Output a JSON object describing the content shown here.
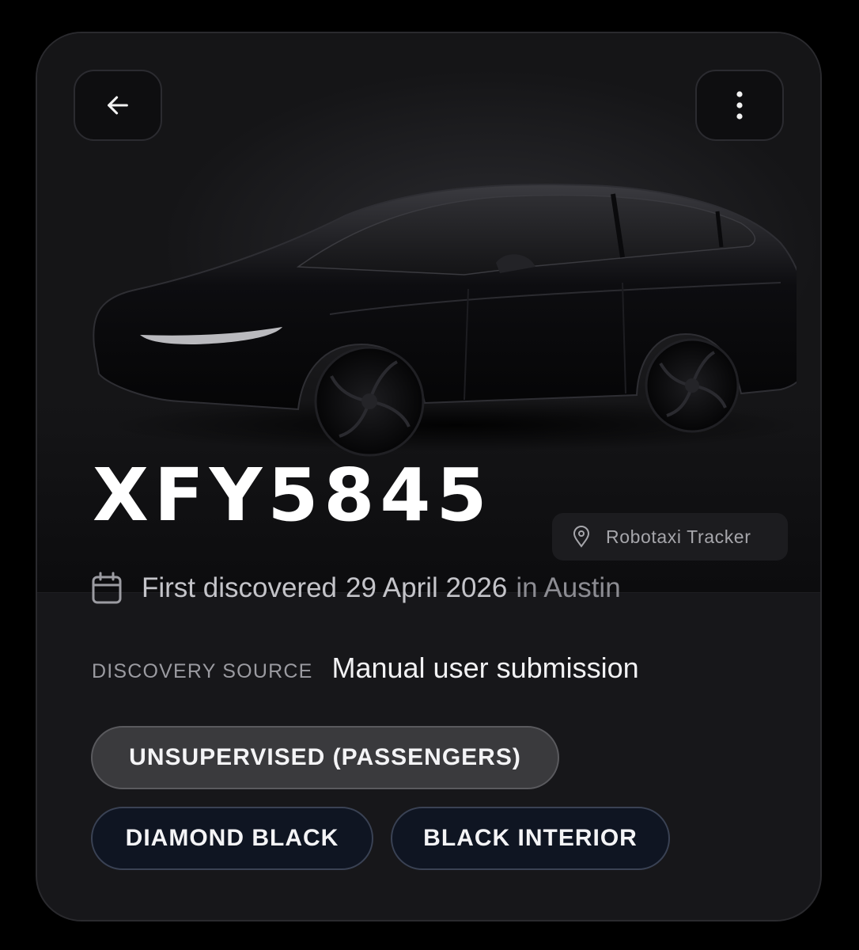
{
  "vehicle": {
    "plate": "XFY5845",
    "discovered_prefix": "First discovered",
    "discovered_date": "29 April 2026",
    "discovered_in": "in Austin",
    "discovery_source_label": "DISCOVERY SOURCE",
    "discovery_source_value": "Manual user submission"
  },
  "badge": {
    "label": "Robotaxi Tracker",
    "icon": "location-pin-icon"
  },
  "tags": [
    {
      "label": "UNSUPERVISED (PASSENGERS)"
    },
    {
      "label": "DIAMOND BLACK"
    },
    {
      "label": "BLACK INTERIOR"
    }
  ],
  "header": {
    "back_icon": "arrow-left-icon",
    "menu_icon": "more-vertical-icon"
  },
  "colors": {
    "background": "#000000",
    "card": "#17171a",
    "neutral_pill": "#3a3a3d",
    "navy_pill": "#0f1522"
  }
}
